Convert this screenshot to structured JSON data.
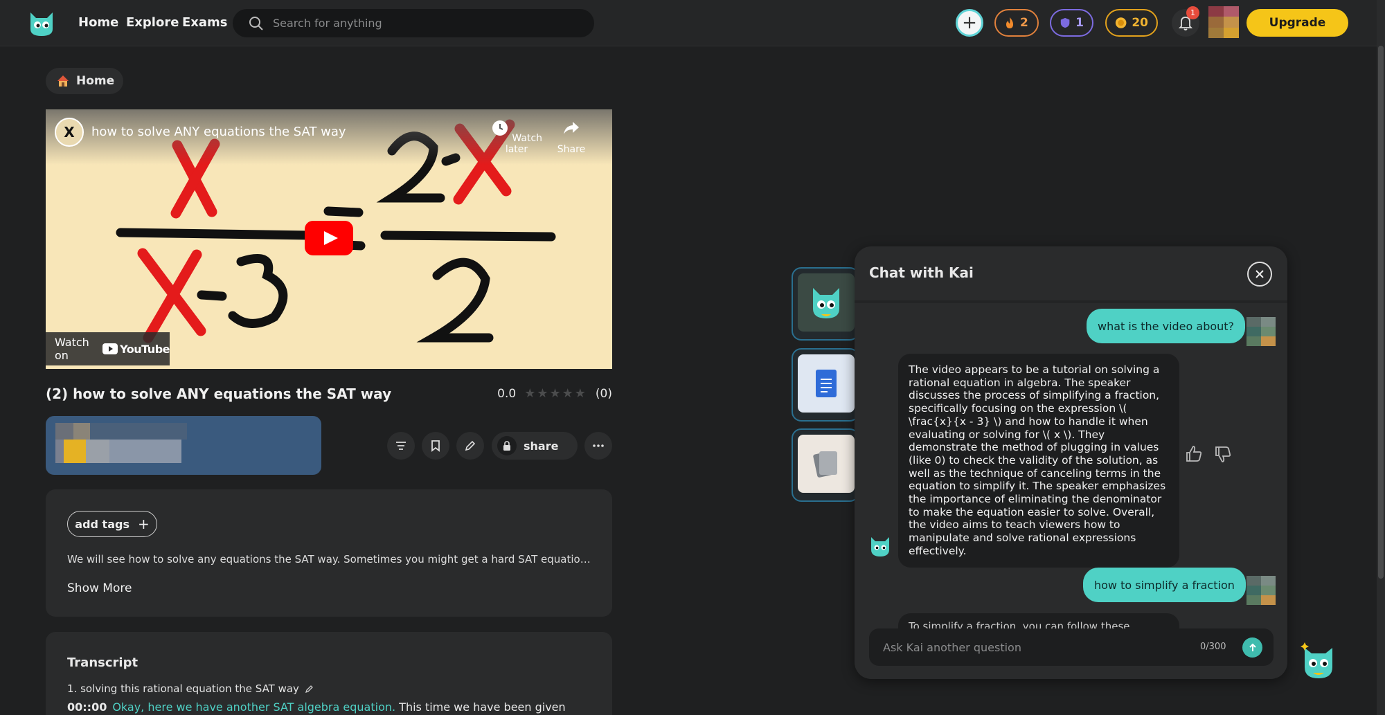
{
  "topbar": {
    "nav": [
      "Home",
      "Explore",
      "Exams"
    ],
    "search_placeholder": "Search for anything",
    "streak_count": "2",
    "level_count": "1",
    "coin_count": "20",
    "notifications_badge": "1",
    "upgrade_label": "Upgrade"
  },
  "breadcrumb": {
    "label": "Home"
  },
  "video": {
    "player_title": "how to solve ANY equations the SAT way",
    "channel_initial": "X",
    "watch_later_label": "Watch later",
    "share_label": "Share",
    "watch_on_label": "Watch on",
    "youtube_label": "YouTube",
    "title": "(2) how to solve ANY equations the SAT way",
    "rating_value": "0.0",
    "rating_count": "(0)",
    "stars_filled": 0,
    "stars_total": 5,
    "share_button": "share"
  },
  "description": {
    "add_tags_label": "add tags",
    "text": "We will see how to solve any equations the SAT way. Sometimes you might get a hard SAT equation b...",
    "show_more_label": "Show More"
  },
  "transcript": {
    "title": "Transcript",
    "section_title": "1. solving this rational equation the SAT way",
    "timestamp": "00::00",
    "highlighted_text": "Okay, here we have another SAT algebra equation.",
    "rest_text": " This time we have been given"
  },
  "chat": {
    "title": "Chat with Kai",
    "messages": [
      {
        "role": "user",
        "text": "what is the video about?"
      },
      {
        "role": "bot",
        "text": "The video appears to be a tutorial on solving a rational equation in algebra. The speaker discusses the process of simplifying a fraction, specifically focusing on the expression \\( \\frac{x}{x - 3} \\) and how to handle it when evaluating or solving for \\( x \\). They demonstrate the method of plugging in values (like 0) to check the validity of the solution, as well as the technique of canceling terms in the equation to simplify it. The speaker emphasizes the importance of eliminating the denominator to make the equation easier to solve. Overall, the video aims to teach viewers how to manipulate and solve rational expressions effectively."
      },
      {
        "role": "user",
        "text": "how to simplify a fraction"
      },
      {
        "role": "bot",
        "text": "To simplify a fraction, you can follow these"
      }
    ],
    "input_placeholder": "Ask Kai another question",
    "char_count": "0/300"
  },
  "colors": {
    "accent_teal": "#4fd1c5",
    "upgrade_yellow": "#f5c518",
    "streak_orange": "#e1813c",
    "level_purple": "#7c6be0",
    "coin_gold": "#e3a21c"
  }
}
